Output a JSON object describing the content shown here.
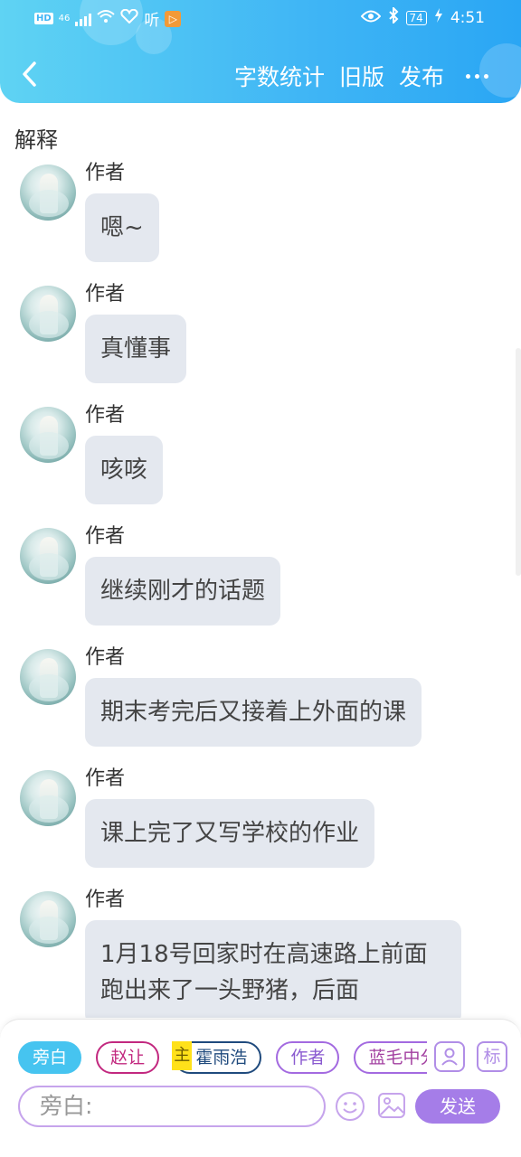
{
  "status_bar": {
    "hd": "HD",
    "network": "46",
    "app_text": "听",
    "app_badge": "▷",
    "battery": "74",
    "time": "4:51"
  },
  "nav": {
    "word_count": "字数统计",
    "old_version": "旧版",
    "publish": "发布"
  },
  "section_title": "解释",
  "messages": [
    {
      "author": "作者",
      "text": "嗯~"
    },
    {
      "author": "作者",
      "text": "真懂事"
    },
    {
      "author": "作者",
      "text": "咳咳"
    },
    {
      "author": "作者",
      "text": "继续刚才的话题"
    },
    {
      "author": "作者",
      "text": "期末考完后又接着上外面的课"
    },
    {
      "author": "作者",
      "text": "课上完了又写学校的作业"
    },
    {
      "author": "作者",
      "text": "1月18号回家时在高速路上前面跑出来了一头野猪，后面"
    }
  ],
  "roles": {
    "narration": "旁白",
    "zhao": "赵让",
    "main_tag": "主",
    "huo": "霍雨浩",
    "author": "作者",
    "lan": "蓝毛中分"
  },
  "toolbar": {
    "mark_label": "标",
    "input_placeholder": "旁白:",
    "send": "发送"
  }
}
